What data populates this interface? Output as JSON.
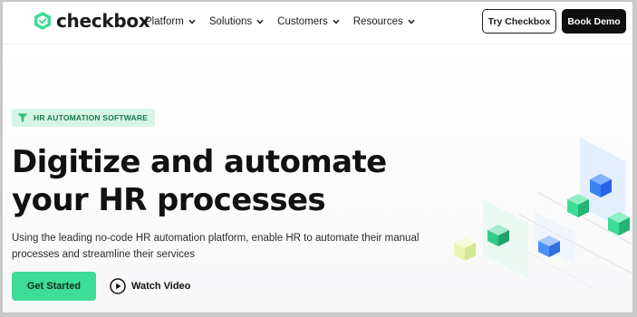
{
  "brand": {
    "name": "checkbox",
    "accent": "#3ddc97",
    "dark": "#0f0f0f"
  },
  "nav": {
    "items": [
      {
        "label": "Platform",
        "icon": "chevron-down-icon"
      },
      {
        "label": "Solutions",
        "icon": "chevron-down-icon"
      },
      {
        "label": "Customers",
        "icon": "chevron-down-icon"
      },
      {
        "label": "Resources",
        "icon": "chevron-down-icon"
      }
    ]
  },
  "header_actions": {
    "try_label": "Try Checkbox",
    "demo_label": "Book Demo"
  },
  "hero": {
    "badge": "HR AUTOMATION SOFTWARE",
    "badge_icon": "funnel-icon",
    "headline_line1": "Digitize and automate",
    "headline_line2": "your HR processes",
    "subtitle_line1": "Using the leading no-code HR automation platform, enable HR to automate their manual",
    "subtitle_line2": "processes and streamline their services",
    "cta_primary": "Get Started",
    "cta_video": "Watch Video",
    "cta_video_icon": "play-circle-icon"
  },
  "illustration": {
    "description_icon": "isometric-cubes-illustration",
    "colors": {
      "green": "#3ddc97",
      "blue": "#3b82f6",
      "lime": "#e8f5b0",
      "panel": "#dbeafe"
    }
  }
}
